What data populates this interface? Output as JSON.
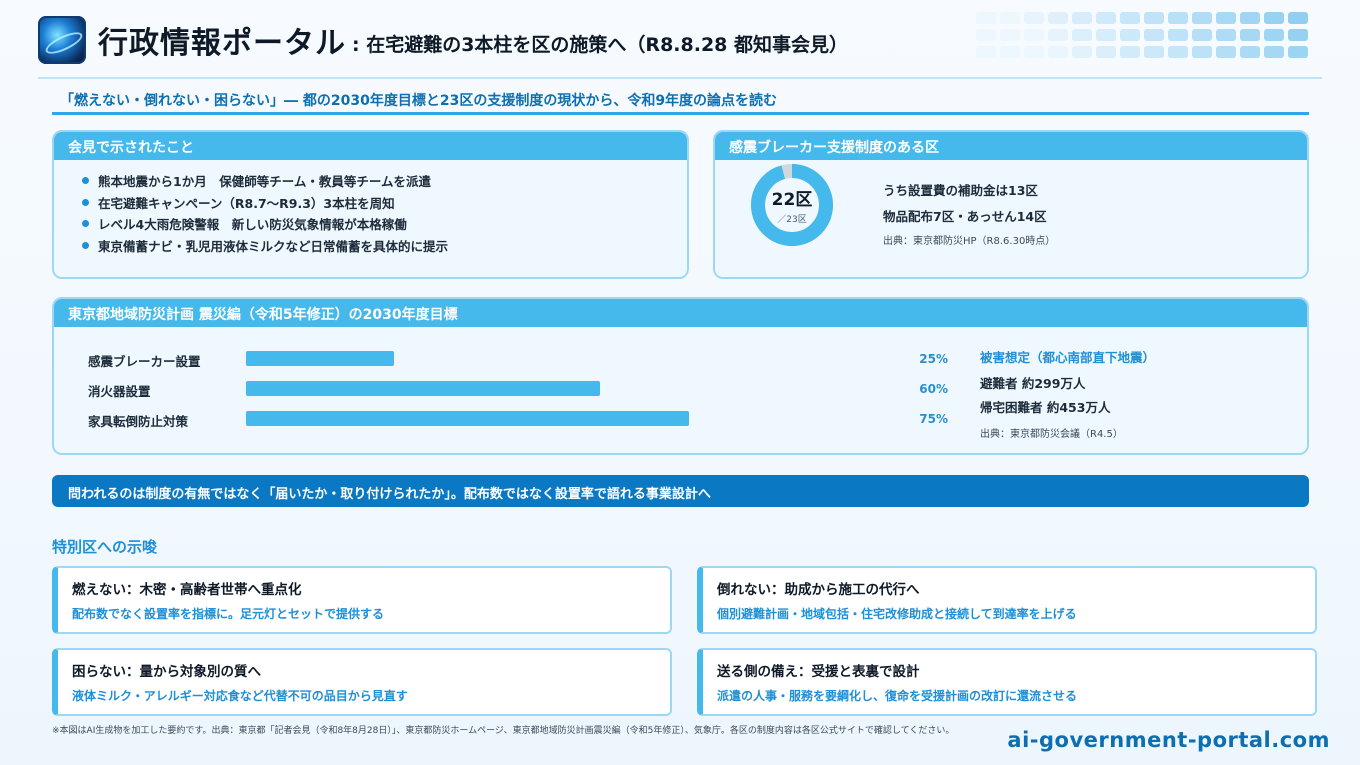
{
  "header": {
    "brand": "行政情報ポータル",
    "title": ": 在宅避難の3本柱を区の施策へ（R8.8.28 都知事会見）"
  },
  "subtitle": "「燃えない・倒れない・困らない」― 都の2030年度目標と23区の支援制度の現状から、令和9年度の論点を読む",
  "announced": {
    "heading": "会見で示されたこと",
    "items": [
      "熊本地震から1か月　保健師等チーム・教員等チームを派遣",
      "在宅避難キャンペーン（R8.7〜R9.3）3本柱を周知",
      "レベル4大雨危険警報　新しい防災気象情報が本格稼働",
      "東京備蓄ナビ・乳児用液体ミルクなど日常備蓄を具体的に提示"
    ]
  },
  "wards": {
    "heading": "感震ブレーカー支援制度のある区",
    "value": 22,
    "total": 23,
    "value_label": "22区",
    "total_label": "／23区",
    "line1": "うち設置費の補助金は13区",
    "line2": "物品配布7区・あっせん14区",
    "source": "出典：東京都防災HP（R8.6.30時点）",
    "color_fill": "#45b8ec",
    "color_rest": "#d0d8de"
  },
  "targets": {
    "heading": "東京都地域防災計画 震災編（令和5年修正）の2030年度目標",
    "rows": [
      {
        "label": "感震ブレーカー設置",
        "value": 25,
        "value_label": "25%"
      },
      {
        "label": "消火器設置",
        "value": 60,
        "value_label": "60%"
      },
      {
        "label": "家具転倒防止対策",
        "value": 75,
        "value_label": "75%"
      }
    ],
    "damage": {
      "title": "被害想定（都心南部直下地震）",
      "line1": "避難者 約299万人",
      "line2": "帰宅困難者 約453万人",
      "source": "出典：東京都防災会議（R4.5）"
    }
  },
  "banner": "問われるのは制度の有無ではなく「届いたか・取り付けられたか」。配布数ではなく設置率で語れる事業設計へ",
  "implications": {
    "title": "特別区への示唆",
    "cards": [
      {
        "head": "燃えない：木密・高齢者世帯へ重点化",
        "body": "配布数でなく設置率を指標に。足元灯とセットで提供する"
      },
      {
        "head": "倒れない：助成から施工の代行へ",
        "body": "個別避難計画・地域包括・住宅改修助成と接続して到達率を上げる"
      },
      {
        "head": "困らない：量から対象別の質へ",
        "body": "液体ミルク・アレルギー対応食など代替不可の品目から見直す"
      },
      {
        "head": "送る側の備え：受援と表裏で設計",
        "body": "派遣の人事・服務を要綱化し、復命を受援計画の改訂に還流させる"
      }
    ]
  },
  "footnote": "※本図はAI生成物を加工した要約です。出典：東京都「記者会見（令和8年8月28日）」、東京都防災ホームページ、東京都地域防災計画震災編（令和5年修正）、気象庁。各区の制度内容は各区公式サイトで確認してください。",
  "site": "ai-government-portal.com"
}
